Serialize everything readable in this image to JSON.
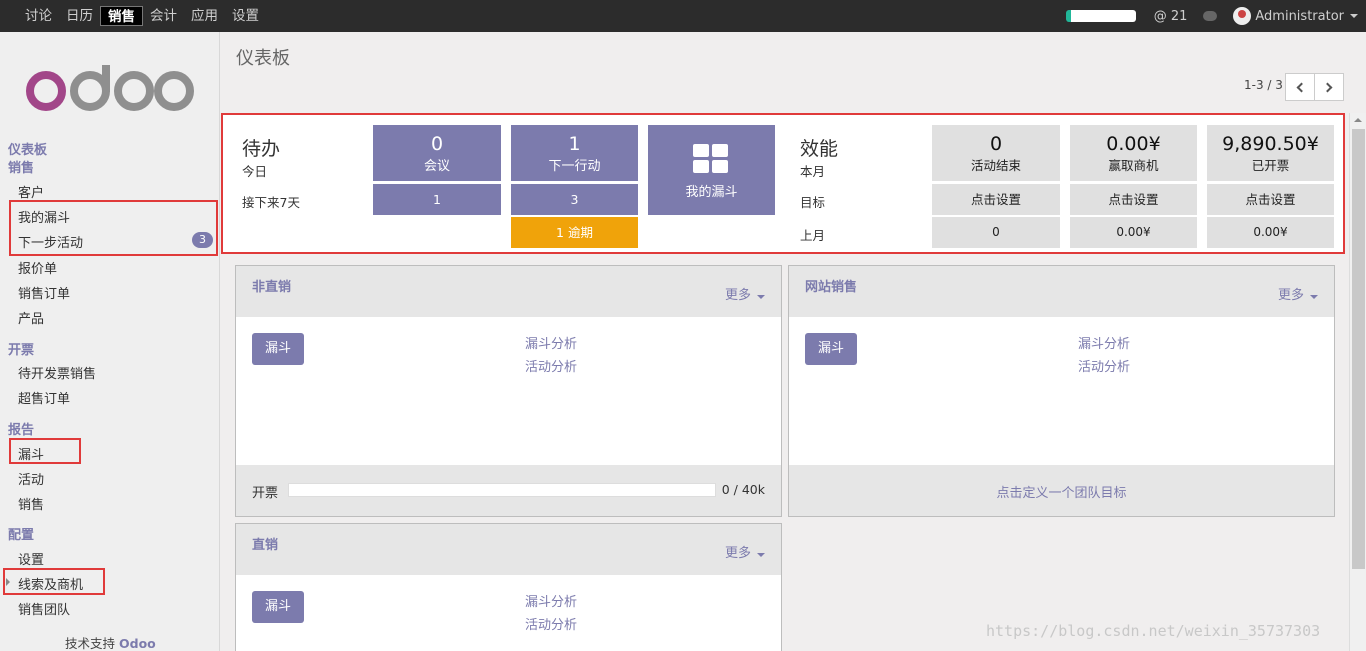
{
  "topbar": {
    "menu": [
      "讨论",
      "日历",
      "销售",
      "会计",
      "应用",
      "设置"
    ],
    "active_index": 2,
    "mentions": "@ 21",
    "user": "Administrator"
  },
  "sidebar": {
    "logo": "odoo",
    "sections": {
      "dashboard": "仪表板",
      "sales": "销售",
      "invoicing": "开票",
      "reports": "报告",
      "config": "配置"
    },
    "items": {
      "customers": "客户",
      "my_pipeline": "我的漏斗",
      "next_activities": "下一步活动",
      "next_activities_badge": "3",
      "quotations": "报价单",
      "sales_orders": "销售订单",
      "products": "产品",
      "to_invoice": "待开发票销售",
      "upselling": "超售订单",
      "funnel": "漏斗",
      "activities": "活动",
      "sales": "销售",
      "settings": "设置",
      "leads": "线索及商机",
      "sales_teams": "销售团队"
    },
    "powered_prefix": "技术支持",
    "powered_brand": "Odoo"
  },
  "breadcrumb": "仪表板",
  "pager": "1-3 / 3",
  "dashboard": {
    "todo_title": "待办",
    "today": "今日",
    "next7": "接下来7天",
    "meetings": {
      "count": "0",
      "label": "会议",
      "next7": "1"
    },
    "next_action": {
      "count": "1",
      "label": "下一行动",
      "next7": "3",
      "overdue": "1 逾期"
    },
    "my_pipeline": "我的漏斗",
    "perf_title": "效能",
    "this_month": "本月",
    "target": "目标",
    "last_month": "上月",
    "done_activities": {
      "value": "0",
      "label": "活动结束",
      "target": "点击设置",
      "last": "0"
    },
    "won": {
      "value": "0.00¥",
      "label": "赢取商机",
      "target": "点击设置",
      "last": "0.00¥"
    },
    "invoiced": {
      "value": "9,890.50¥",
      "label": "已开票",
      "target": "点击设置",
      "last": "0.00¥"
    }
  },
  "teams": {
    "indirect": {
      "title": "非直销",
      "more": "更多",
      "button": "漏斗",
      "link1": "漏斗分析",
      "link2": "活动分析",
      "foot_label": "开票",
      "progress": 0,
      "progress_text": "0 / 40k"
    },
    "website": {
      "title": "网站销售",
      "more": "更多",
      "button": "漏斗",
      "link1": "漏斗分析",
      "link2": "活动分析",
      "foot_link": "点击定义一个团队目标"
    },
    "direct": {
      "title": "直销",
      "more": "更多",
      "button": "漏斗",
      "link1": "漏斗分析",
      "link2": "活动分析"
    }
  },
  "watermark": "https://blog.csdn.net/weixin_35737303"
}
